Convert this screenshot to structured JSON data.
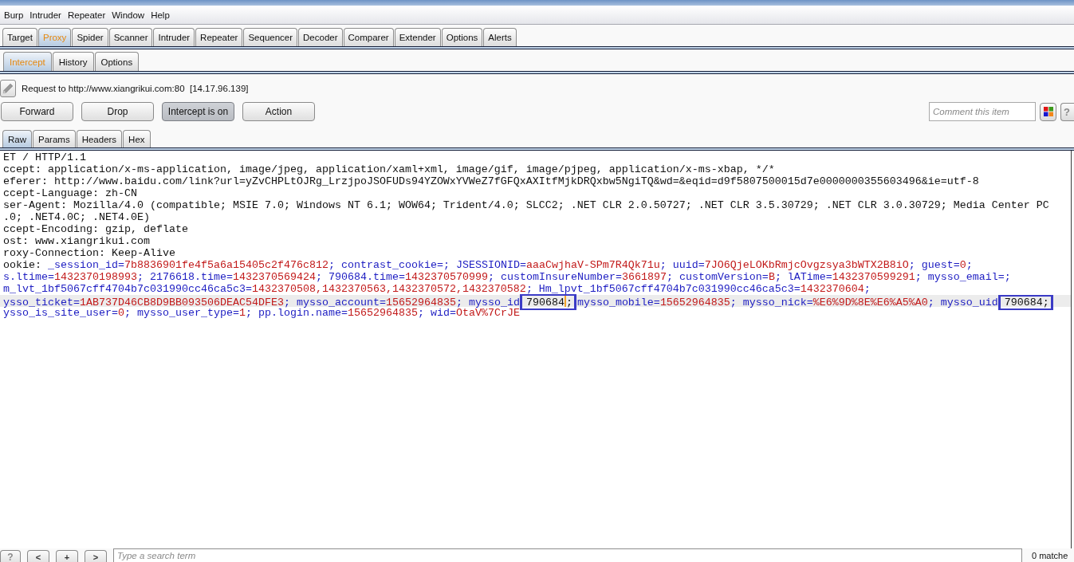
{
  "menu_bar": [
    "Burp",
    "Intruder",
    "Repeater",
    "Window",
    "Help"
  ],
  "main_tabs": [
    {
      "label": "Target",
      "selected": false
    },
    {
      "label": "Proxy",
      "selected": true
    },
    {
      "label": "Spider",
      "selected": false
    },
    {
      "label": "Scanner",
      "selected": false
    },
    {
      "label": "Intruder",
      "selected": false
    },
    {
      "label": "Repeater",
      "selected": false
    },
    {
      "label": "Sequencer",
      "selected": false
    },
    {
      "label": "Decoder",
      "selected": false
    },
    {
      "label": "Comparer",
      "selected": false
    },
    {
      "label": "Extender",
      "selected": false
    },
    {
      "label": "Options",
      "selected": false
    },
    {
      "label": "Alerts",
      "selected": false
    }
  ],
  "proxy_tabs": [
    {
      "label": "Intercept",
      "selected": true
    },
    {
      "label": "History",
      "selected": false
    },
    {
      "label": "Options",
      "selected": false
    }
  ],
  "request_info": "Request to http://www.xiangrikui.com:80  [14.17.96.139]",
  "actions": [
    {
      "label": "Forward",
      "pressed": false
    },
    {
      "label": "Drop",
      "pressed": false
    },
    {
      "label": "Intercept is on",
      "pressed": true
    },
    {
      "label": "Action",
      "pressed": false
    }
  ],
  "comment": {
    "placeholder": "Comment this item"
  },
  "help_button": "?",
  "message_tabs": [
    {
      "label": "Raw",
      "selected": true
    },
    {
      "label": "Params",
      "selected": false
    },
    {
      "label": "Headers",
      "selected": false
    },
    {
      "label": "Hex",
      "selected": false
    }
  ],
  "raw_lines": [
    {
      "current": false,
      "segments": [
        {
          "kind": "plain",
          "text": "ET / HTTP/1.1"
        }
      ]
    },
    {
      "current": false,
      "segments": [
        {
          "kind": "plain",
          "text": "ccept: application/x-ms-application, image/jpeg, application/xaml+xml, image/gif, image/pjpeg, application/x-ms-xbap, */*"
        }
      ]
    },
    {
      "current": false,
      "segments": [
        {
          "kind": "plain",
          "text": "eferer: http://www.baidu.com/link?url=yZvCHPLtOJRg_LrzjpoJSOFUDs94YZOWxYVWeZ7fGFQxAXItfMjkDRQxbw5NgiTQ&wd=&eqid=d9f5807500015d7e0000000355603496&ie=utf-8"
        }
      ]
    },
    {
      "current": false,
      "segments": [
        {
          "kind": "plain",
          "text": "ccept-Language: zh-CN"
        }
      ]
    },
    {
      "current": false,
      "segments": [
        {
          "kind": "plain",
          "text": "ser-Agent: Mozilla/4.0 (compatible; MSIE 7.0; Windows NT 6.1; WOW64; Trident/4.0; SLCC2; .NET CLR 2.0.50727; .NET CLR 3.5.30729; .NET CLR 3.0.30729; Media Center PC"
        }
      ]
    },
    {
      "current": false,
      "segments": [
        {
          "kind": "plain",
          "text": ".0; .NET4.0C; .NET4.0E)"
        }
      ]
    },
    {
      "current": false,
      "segments": [
        {
          "kind": "plain",
          "text": "ccept-Encoding: gzip, deflate"
        }
      ]
    },
    {
      "current": false,
      "segments": [
        {
          "kind": "plain",
          "text": "ost: www.xiangrikui.com"
        }
      ]
    },
    {
      "current": false,
      "segments": [
        {
          "kind": "plain",
          "text": "roxy-Connection: Keep-Alive"
        }
      ]
    },
    {
      "current": false,
      "segments": [
        {
          "kind": "plain",
          "text": "ookie: "
        },
        {
          "kind": "name",
          "text": "_session_id="
        },
        {
          "kind": "value",
          "text": "7b8836901fe4f5a6a15405c2f476c812"
        },
        {
          "kind": "name",
          "text": "; contrast_cookie=; JSESSIONID="
        },
        {
          "kind": "value",
          "text": "aaaCwjhaV-SPm7R4Qk71u"
        },
        {
          "kind": "name",
          "text": "; uuid="
        },
        {
          "kind": "value",
          "text": "7JO6QjeLOKbRmjcOvgzsya3bWTX2B8iO"
        },
        {
          "kind": "name",
          "text": "; guest="
        },
        {
          "kind": "value",
          "text": "0"
        },
        {
          "kind": "name",
          "text": ";"
        }
      ]
    },
    {
      "current": false,
      "segments": [
        {
          "kind": "name",
          "text": "s.ltime="
        },
        {
          "kind": "value",
          "text": "1432370198993"
        },
        {
          "kind": "name",
          "text": "; 2176618.time="
        },
        {
          "kind": "value",
          "text": "1432370569424"
        },
        {
          "kind": "name",
          "text": "; 790684.time="
        },
        {
          "kind": "value",
          "text": "1432370570999"
        },
        {
          "kind": "name",
          "text": "; customInsureNumber="
        },
        {
          "kind": "value",
          "text": "3661897"
        },
        {
          "kind": "name",
          "text": "; customVersion="
        },
        {
          "kind": "value",
          "text": "B"
        },
        {
          "kind": "name",
          "text": "; lATime="
        },
        {
          "kind": "value",
          "text": "1432370599291"
        },
        {
          "kind": "name",
          "text": "; mysso_email=;"
        }
      ]
    },
    {
      "current": false,
      "segments": [
        {
          "kind": "name",
          "text": "m_lvt_1bf5067cff4704b7c031990cc46ca5c3="
        },
        {
          "kind": "value",
          "text": "1432370508,1432370563,1432370572,1432370582"
        },
        {
          "kind": "name",
          "text": "; Hm_lpvt_1bf5067cff4704b7c031990cc46ca5c3="
        },
        {
          "kind": "value",
          "text": "1432370604"
        },
        {
          "kind": "name",
          "text": ";"
        }
      ]
    },
    {
      "current": true,
      "segments": [
        {
          "kind": "name",
          "text": "ysso_ticket="
        },
        {
          "kind": "value",
          "text": "1AB737D46CB8D9BB093506DEAC54DFE3"
        },
        {
          "kind": "name",
          "text": "; mysso_account="
        },
        {
          "kind": "value",
          "text": "15652964835"
        },
        {
          "kind": "name",
          "text": "; mysso_id"
        },
        {
          "kind": "box",
          "parts": [
            {
              "kind": "plain",
              "text": "790684"
            },
            {
              "kind": "cursor"
            },
            {
              "kind": "plain",
              "text": ";"
            }
          ]
        },
        {
          "kind": "name",
          "text": " mysso_mobile="
        },
        {
          "kind": "value",
          "text": "15652964835"
        },
        {
          "kind": "name",
          "text": "; mysso_nick="
        },
        {
          "kind": "value",
          "text": "%E6%9D%8E%E6%A5%A0"
        },
        {
          "kind": "name",
          "text": "; mysso_uid"
        },
        {
          "kind": "box",
          "parts": [
            {
              "kind": "plain",
              "text": "790684;"
            }
          ]
        }
      ]
    },
    {
      "current": false,
      "segments": [
        {
          "kind": "name",
          "text": "ysso_is_site_user="
        },
        {
          "kind": "value",
          "text": "0"
        },
        {
          "kind": "name",
          "text": "; mysso_user_type="
        },
        {
          "kind": "value",
          "text": "1"
        },
        {
          "kind": "name",
          "text": "; pp.login.name="
        },
        {
          "kind": "value",
          "text": "15652964835"
        },
        {
          "kind": "name",
          "text": "; wid="
        },
        {
          "kind": "value",
          "text": "OtaV%7CrJE"
        }
      ]
    }
  ],
  "search_bar": {
    "buttons": [
      "?",
      "<",
      "+",
      ">"
    ],
    "placeholder": "Type a search term",
    "matches": "0 matche"
  }
}
